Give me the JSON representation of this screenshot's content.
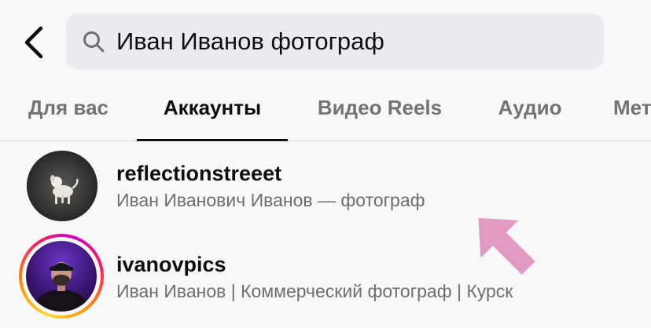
{
  "search": {
    "query": "Иван Иванов фотограф"
  },
  "tabs": [
    {
      "label": "Для вас",
      "active": false
    },
    {
      "label": "Аккаунты",
      "active": true
    },
    {
      "label": "Видео Reels",
      "active": false
    },
    {
      "label": "Аудио",
      "active": false
    },
    {
      "label": "Мет",
      "active": false
    }
  ],
  "results": [
    {
      "username": "reflectionstreeet",
      "subtitle": "Иван Иванович Иванов — фотограф",
      "has_story": false
    },
    {
      "username": "ivanovpics",
      "subtitle": "Иван Иванов | Коммерческий фотограф | Курск",
      "has_story": true
    }
  ],
  "colors": {
    "background": "#f8f8f9",
    "search_field": "#ebebed",
    "active_tab": "#0f0f0f",
    "inactive_tab": "#737373",
    "subtitle": "#6e6e6e",
    "annotation_arrow": "#e29ac3"
  },
  "icons": {
    "back": "chevron-left-icon",
    "search": "search-icon",
    "annotation": "arrow-icon"
  }
}
